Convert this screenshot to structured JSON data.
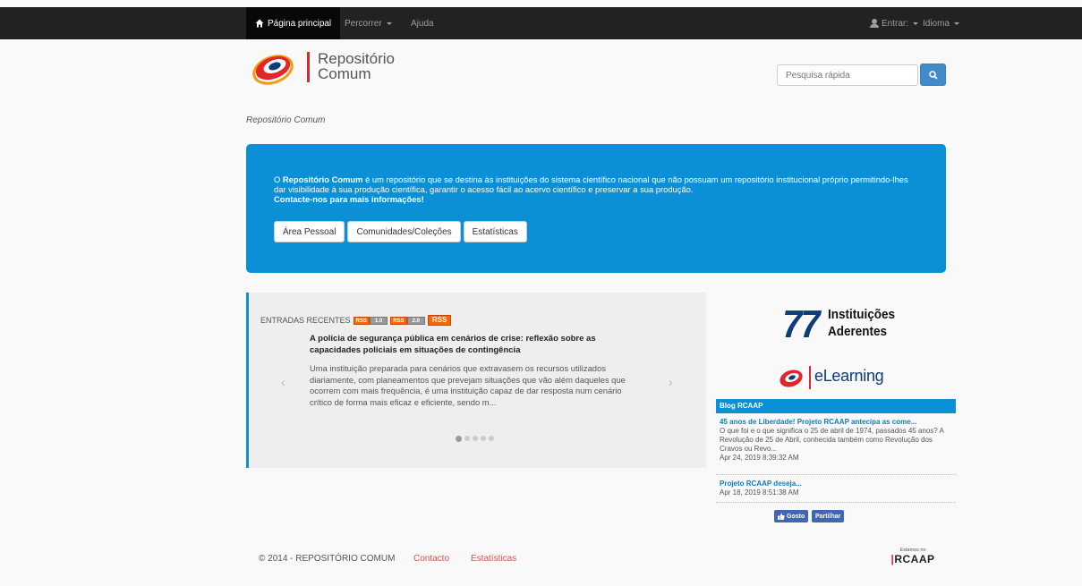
{
  "topnav": {
    "home": "Página principal",
    "browse": "Percorrer",
    "help": "Ajuda",
    "login": "Entrar:",
    "language": "Idioma"
  },
  "logo": {
    "line1": "Repositório",
    "line2": "Comum"
  },
  "search": {
    "placeholder": "Pesquisa rápida"
  },
  "breadcrumb": "Repositório Comum",
  "jumbotron": {
    "lead_prefix": "O ",
    "lead_bold": "Repositório Comum",
    "lead_text": " é um repositório que se destina às instituições do sistema científico nacional que não possuam um repositório institucional próprio permitindo-lhes dar visibilidade à sua produção científica, garantir o acesso fácil ao acervo científico e preservar a sua produção.",
    "contact": "Contacte-nos para mais informações!",
    "buttons": [
      "Área Pessoal",
      "Comunidades/Coleções",
      "Estatísticas"
    ]
  },
  "recent": {
    "header": "ENTRADAS RECENTES",
    "rss_badges": [
      {
        "a": "RSS",
        "b": "1.0"
      },
      {
        "a": "RSS",
        "b": "2.0"
      }
    ],
    "rss_big": "RSS",
    "item_title": "A polícia de segurança pública em cenários de crise: reflexão sobre as capacidades policiais em situações de contingência",
    "item_body": "Uma instituição preparada para cenários que extravasem os recursos utilizados diariamente, com planeamentos que prevejam situações que vão além daqueles que ocorrem com mais frequência, é uma instituição capaz de dar resposta num cenário crítico de forma mais eficaz e eficiente, sendo m...",
    "prev": "‹",
    "next": "›",
    "slides": 5,
    "active_slide": 1
  },
  "institutions": {
    "count": "77",
    "line1": "Instituições",
    "line2": "Aderentes"
  },
  "elearning": {
    "label": "eLearning"
  },
  "blog": {
    "header": "Blog RCAAP",
    "items": [
      {
        "title": "45 anos de Liberdade! Projeto RCAAP antecipa as come...",
        "text": "O que foi e o que significa o 25 de abril de 1974, passados 45 anos? A Revolução de 25 de Abril, conhecida também como Revolução dos Cravos ou Revo...",
        "date": "Apr 24, 2019 8:39:32 AM"
      },
      {
        "title": "Projeto RCAAP deseja...",
        "text": "",
        "date": "Apr 18, 2019 8:51:38 AM"
      }
    ]
  },
  "facebook": {
    "like": "Gosto",
    "share": "Partilhar"
  },
  "footer": {
    "copyright": "© 2014 - REPOSITÓRIO COMUM",
    "contact": "Contacto",
    "stats": "Estatísticas",
    "badge_small": "Estamos no",
    "badge_big": "RCAAP"
  },
  "colors": {
    "accent": "#0b8fd6",
    "brand_red": "#e2262a",
    "navbar": "#222222"
  }
}
